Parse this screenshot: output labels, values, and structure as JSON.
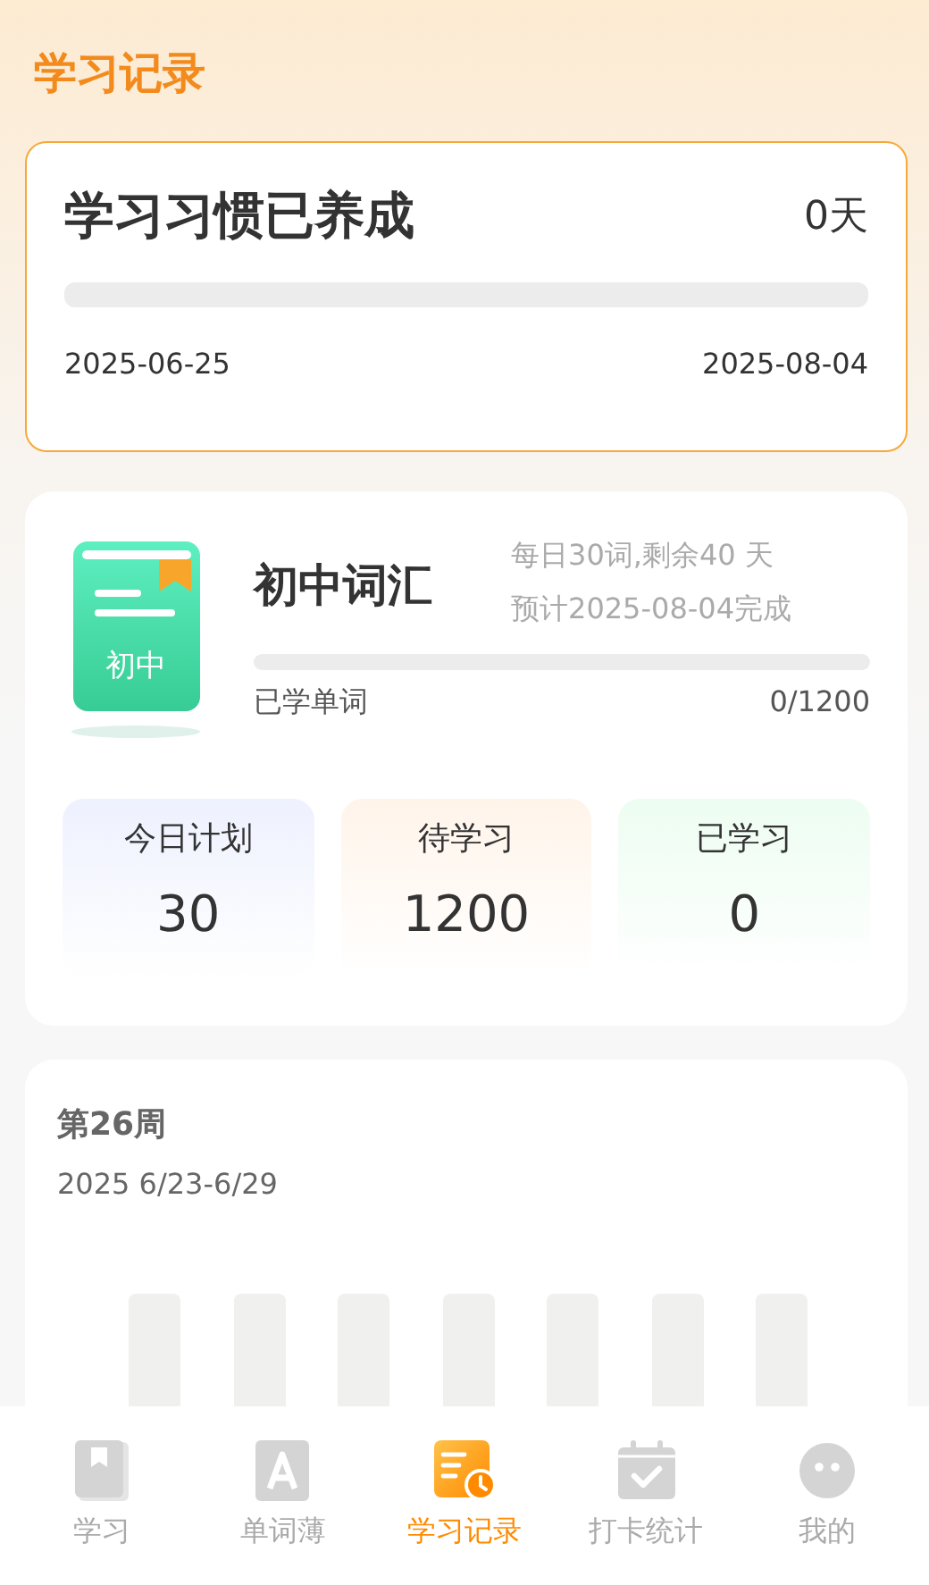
{
  "header": {
    "title": "学习记录"
  },
  "habit": {
    "title": "学习习惯已养成",
    "days": "0天",
    "level": 0,
    "start_date": "2025-06-25",
    "end_date": "2025-08-04"
  },
  "vocabulary": {
    "book_label": "初中",
    "name": "初中词汇",
    "daily_info": "每日30词,剩余40 天",
    "finish_info": "预计2025-08-04完成",
    "level": 0,
    "learned_label": "已学单词",
    "learned_count": "0/1200",
    "stats": [
      {
        "label": "今日计划",
        "value": "30",
        "color": "#eef1fe"
      },
      {
        "label": "待学习",
        "value": "1200",
        "color": "#fff4ea"
      },
      {
        "label": "已学习",
        "value": "0",
        "color": "#edfdf1"
      }
    ]
  },
  "week": {
    "title": "第26周",
    "range": "2025 6/23-6/29"
  },
  "tab_bar": [
    {
      "label": "学习",
      "kind": "book",
      "selected": false
    },
    {
      "label": "单词薄",
      "kind": "letter",
      "selected": false
    },
    {
      "label": "学习记录",
      "kind": "record",
      "selected": true
    },
    {
      "label": "打卡统计",
      "kind": "calendar",
      "selected": false
    },
    {
      "label": "我的",
      "kind": "face",
      "selected": false
    }
  ]
}
